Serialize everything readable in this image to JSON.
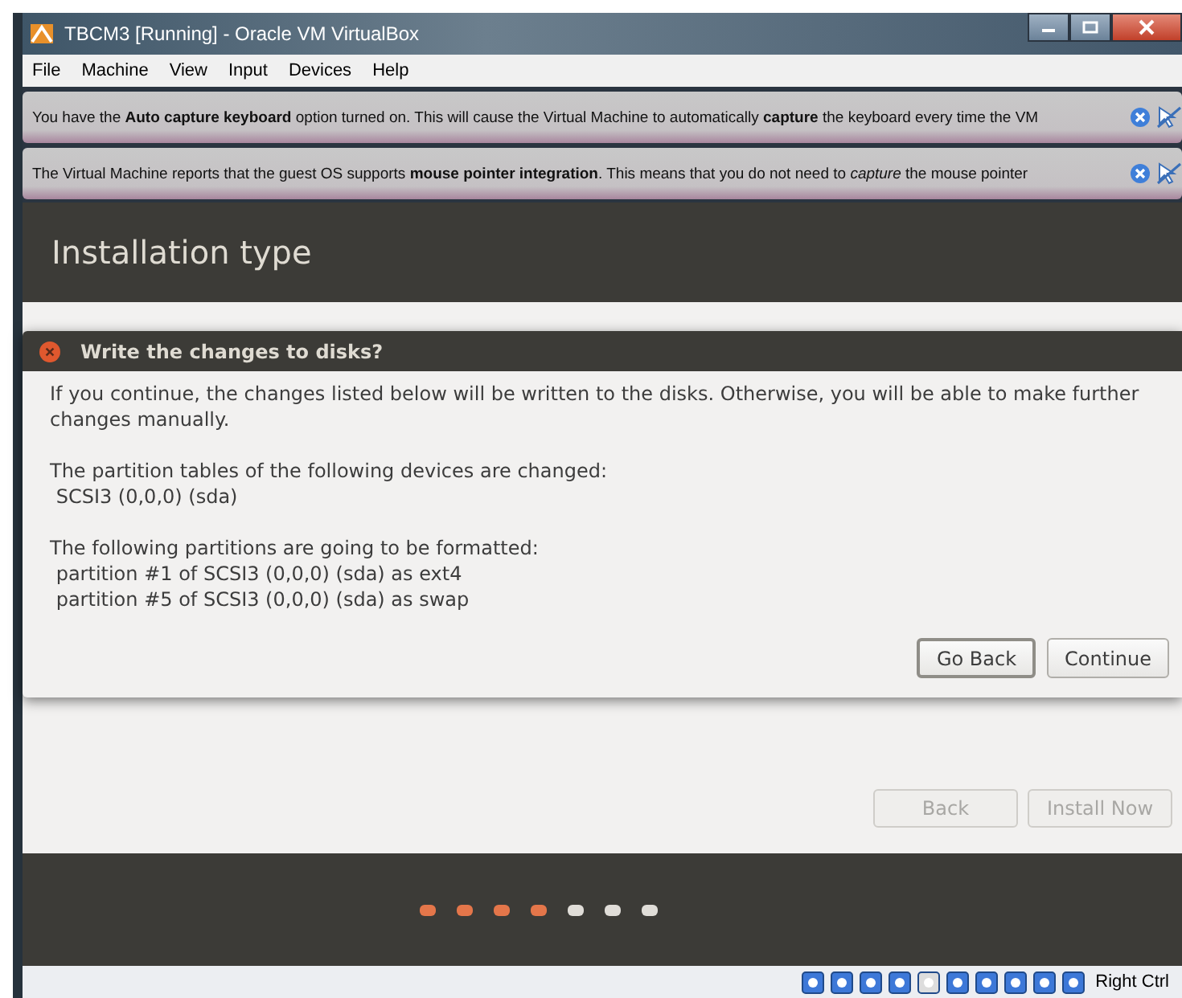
{
  "window": {
    "title": "TBCM3 [Running] - Oracle VM VirtualBox"
  },
  "menu": [
    "File",
    "Machine",
    "View",
    "Input",
    "Devices",
    "Help"
  ],
  "banners": [
    {
      "text": "You have the **Auto capture keyboard** option turned on. This will cause the Virtual Machine to automatically **capture** the keyboard every time the VM"
    },
    {
      "text": "The Virtual Machine reports that the guest OS supports **mouse pointer integration**. This means that you do not need to *capture* the mouse pointer"
    }
  ],
  "installer": {
    "heading": "Installation type",
    "dialog": {
      "title": "Write the changes to disks?",
      "paragraphs": [
        "If you continue, the changes listed below will be written to the disks. Otherwise, you will be able to make further changes manually.",
        "The partition tables of the following devices are changed:\n SCSI3 (0,0,0) (sda)",
        "The following partitions are going to be formatted:\n partition #1 of SCSI3 (0,0,0) (sda) as ext4\n partition #5 of SCSI3 (0,0,0) (sda) as swap"
      ],
      "buttons": [
        {
          "label": "Go Back",
          "focused": true
        },
        {
          "label": "Continue",
          "focused": false
        }
      ]
    },
    "buttons": [
      {
        "label": "Back",
        "disabled": true
      },
      {
        "label": "Install Now",
        "disabled": true
      }
    ],
    "steps": [
      {
        "done": true
      },
      {
        "done": true
      },
      {
        "done": true
      },
      {
        "done": true
      },
      {
        "done": false
      },
      {
        "done": false
      },
      {
        "done": false
      }
    ]
  },
  "status_bar": {
    "host_key": "Right Ctrl"
  }
}
